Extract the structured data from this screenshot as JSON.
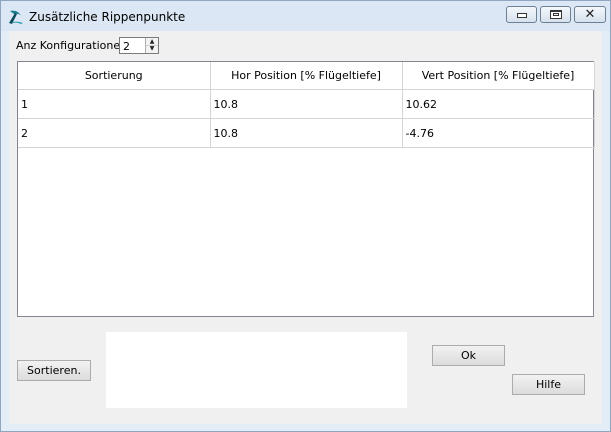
{
  "window": {
    "title": "Zusätzliche Rippenpunkte",
    "min_glyph": "",
    "max_glyph": "",
    "close_glyph": "✕"
  },
  "config": {
    "label": "Anz Konfigurationen",
    "value": "2"
  },
  "table": {
    "headers": [
      "Sortierung",
      "Hor Position [% Flügeltiefe]",
      "Vert Position [% Flügeltiefe]"
    ],
    "rows": [
      [
        "1",
        "10.8",
        "10.62"
      ],
      [
        "2",
        "10.8",
        "-4.76"
      ]
    ]
  },
  "buttons": {
    "sort": "Sortieren.",
    "ok": "Ok",
    "help": "Hilfe"
  }
}
